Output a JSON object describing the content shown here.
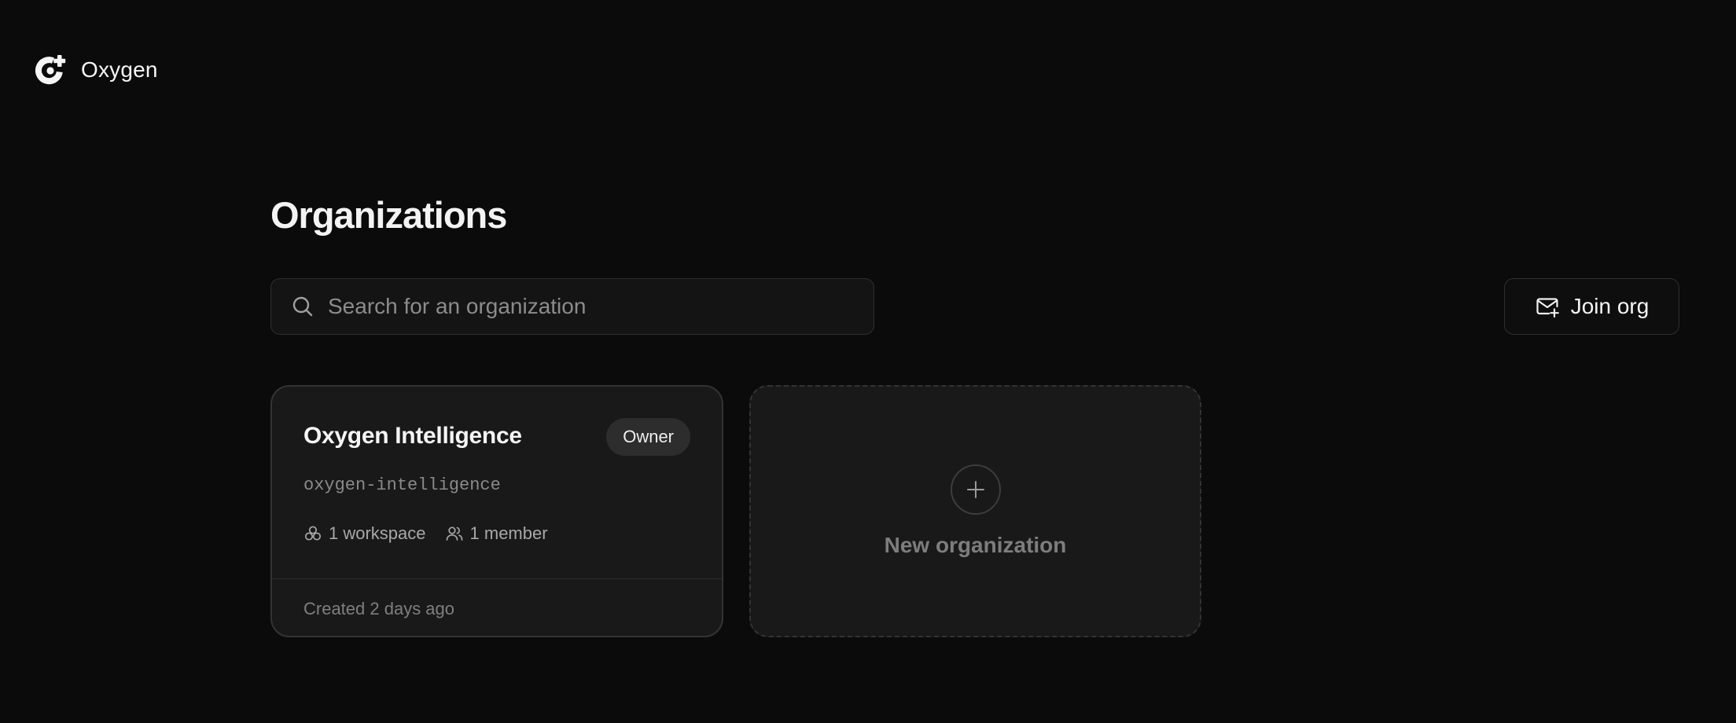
{
  "app": {
    "name": "Oxygen",
    "logo_icon": "oxygen-logo-icon"
  },
  "page": {
    "title": "Organizations"
  },
  "search": {
    "placeholder": "Search for an organization",
    "value": "",
    "icon": "search-icon"
  },
  "join_button": {
    "label": "Join org",
    "icon": "mail-plus-icon"
  },
  "organizations": [
    {
      "name": "Oxygen Intelligence",
      "role": "Owner",
      "slug": "oxygen-intelligence",
      "workspaces": "1 workspace",
      "workspaces_icon": "workspaces-icon",
      "members": "1 member",
      "members_icon": "users-icon",
      "created": "Created 2 days ago"
    }
  ],
  "new_organization": {
    "label": "New organization",
    "icon": "plus-icon"
  },
  "colors": {
    "background": "#0b0b0b",
    "card": "#191919",
    "border": "#333333",
    "text": "#f5f5f5",
    "muted": "#8a8a8a",
    "badge": "#2d2d2d"
  }
}
